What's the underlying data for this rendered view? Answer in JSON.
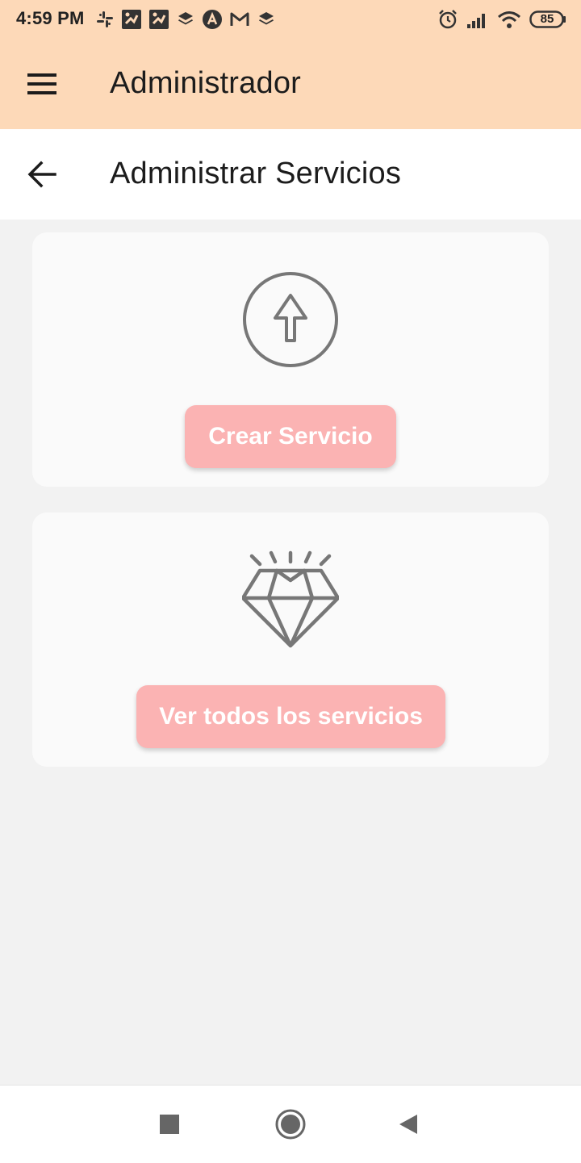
{
  "status_bar": {
    "time": "4:59 PM",
    "battery_level": "85",
    "notification_icons": [
      "slack-icon",
      "tool-icon",
      "tool-icon",
      "layers-icon",
      "triangle-badge-icon",
      "gmail-icon",
      "layers-icon"
    ],
    "system_icons": [
      "alarm-icon",
      "signal-icon",
      "wifi-icon",
      "battery-icon"
    ]
  },
  "app_bar": {
    "title": "Administrador",
    "menu_icon": "menu-icon",
    "background": "#fdd9b8"
  },
  "sub_header": {
    "title": "Administrar Servicios",
    "back_icon": "arrow-left-icon"
  },
  "cards": [
    {
      "icon": "upload-circle-icon",
      "button_label": "Crear Servicio"
    },
    {
      "icon": "diamond-icon",
      "button_label": "Ver todos los servicios"
    }
  ],
  "colors": {
    "button": "#fbb3b3",
    "button_text": "#ffffff",
    "icon_gray": "#777777",
    "page_background": "#f2f2f2"
  },
  "nav_bar": {
    "buttons": [
      "recents-square-icon",
      "home-circle-icon",
      "back-triangle-icon"
    ]
  }
}
